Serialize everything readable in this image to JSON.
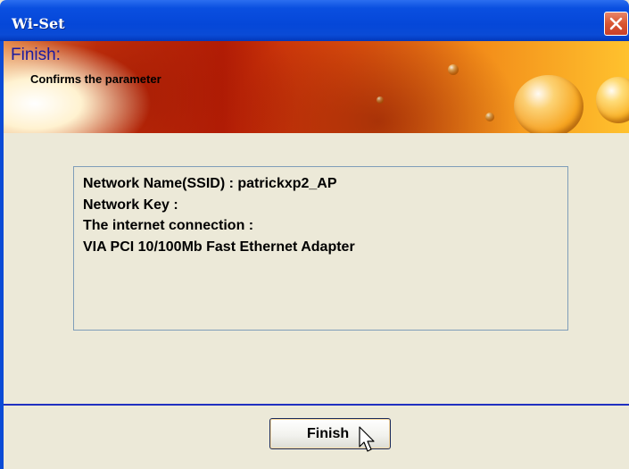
{
  "window": {
    "title": "Wi-Set",
    "close_icon": "close-icon"
  },
  "banner": {
    "heading": "Finish:",
    "subheading": "Confirms the parameter"
  },
  "info": {
    "lines": [
      "Network Name(SSID) : patrickxp2_AP",
      "Network Key :",
      "The internet connection :",
      "VIA PCI 10/100Mb Fast Ethernet Adapter"
    ]
  },
  "footer": {
    "finish_label": "Finish"
  },
  "colors": {
    "titlebar": "#0a4fe0",
    "heading": "#1a1aa0",
    "separator": "#2030c0"
  }
}
